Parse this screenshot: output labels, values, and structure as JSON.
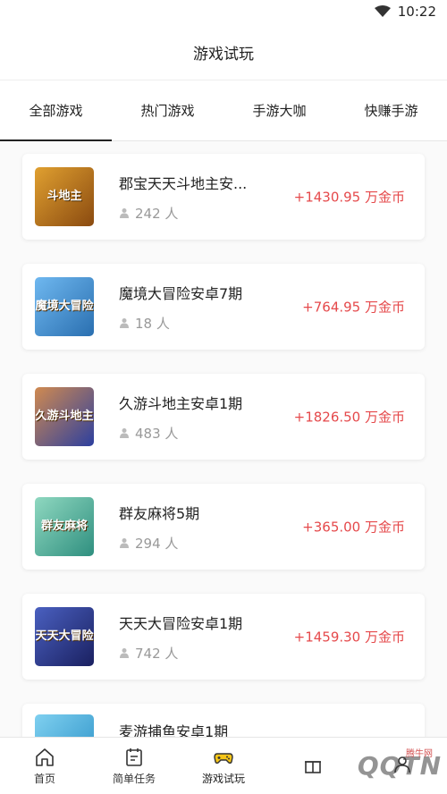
{
  "status": {
    "time": "10:22"
  },
  "header": {
    "title": "游戏试玩"
  },
  "tabs": [
    {
      "label": "全部游戏",
      "active": true
    },
    {
      "label": "热门游戏",
      "active": false
    },
    {
      "label": "手游大咖",
      "active": false
    },
    {
      "label": "快赚手游",
      "active": false
    }
  ],
  "games": [
    {
      "name": "郡宝天天斗地主安...",
      "players": "242 人",
      "reward": "+1430.95 万金币",
      "thumb_label": "斗地主",
      "thumb_color": "#b5651d"
    },
    {
      "name": "魔境大冒险安卓7期",
      "players": "18 人",
      "reward": "+764.95 万金币",
      "thumb_label": "魔境大冒险",
      "thumb_color": "#4a8fd1"
    },
    {
      "name": "久游斗地主安卓1期",
      "players": "483 人",
      "reward": "+1826.50 万金币",
      "thumb_label": "久游斗地主",
      "thumb_color": "#3a5bbf"
    },
    {
      "name": "群友麻将5期",
      "players": "294 人",
      "reward": "+365.00 万金币",
      "thumb_label": "群友麻将",
      "thumb_color": "#3fa7a0"
    },
    {
      "name": "天天大冒险安卓1期",
      "players": "742 人",
      "reward": "+1459.30 万金币",
      "thumb_label": "天天大冒险",
      "thumb_color": "#2c3f8f"
    },
    {
      "name": "麦游捕鱼安卓1期",
      "players": "",
      "reward": "",
      "thumb_label": "",
      "thumb_color": "#2a9fd6"
    }
  ],
  "bottom_nav": [
    {
      "label": "首页",
      "icon": "home-icon"
    },
    {
      "label": "简单任务",
      "icon": "task-icon"
    },
    {
      "label": "游戏试玩",
      "icon": "gamepad-icon"
    },
    {
      "label": "",
      "icon": "gift-icon"
    },
    {
      "label": "",
      "icon": "user-icon"
    }
  ],
  "watermark": {
    "text": "QQTN",
    "small": "腾牛网"
  },
  "colors": {
    "reward": "#e5494b",
    "accent": "#222222"
  }
}
